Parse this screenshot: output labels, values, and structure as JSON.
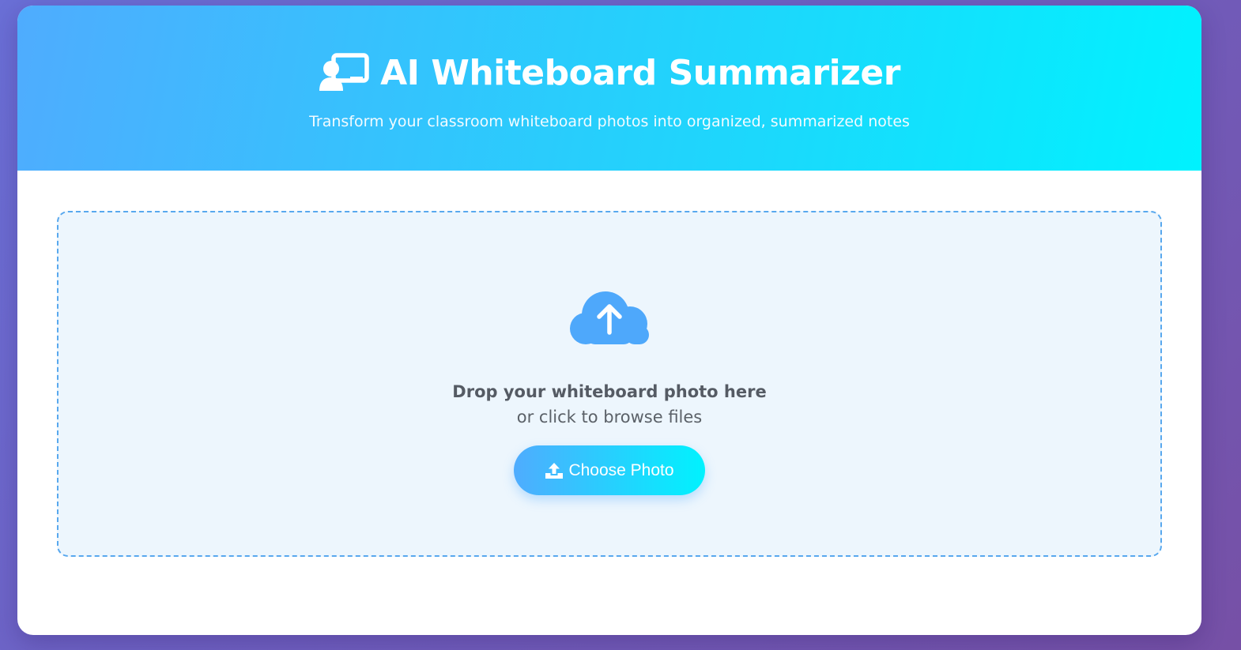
{
  "header": {
    "title": "AI Whiteboard Summarizer",
    "title_icon": "chalkboard-teacher-icon",
    "subtitle": "Transform your classroom whiteboard photos into organized, summarized notes"
  },
  "upload": {
    "icon": "cloud-upload-icon",
    "title": "Drop your whiteboard photo here",
    "subtitle": "or click to browse files",
    "button_label": "Choose Photo",
    "button_icon": "upload-icon"
  },
  "colors": {
    "accent_start": "#4facfe",
    "accent_end": "#00f2fe",
    "page_background": "#7060c4",
    "dropzone_background": "#edf6fd",
    "dropzone_border": "#58a8ee"
  }
}
